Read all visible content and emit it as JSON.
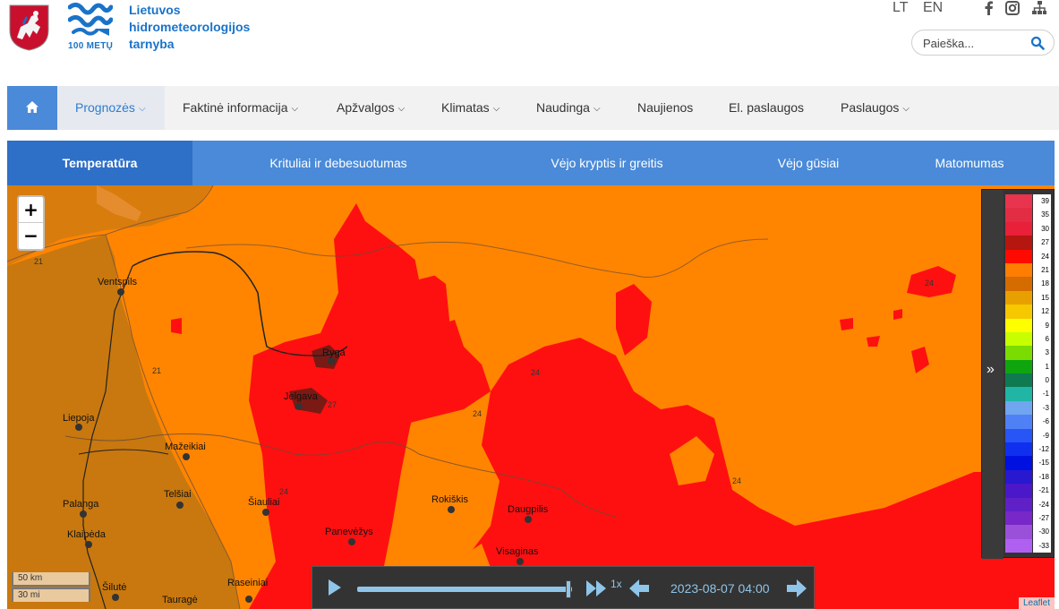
{
  "header": {
    "org_name_line1": "Lietuvos",
    "org_name_line2": "hidrometeorologijos",
    "org_name_line3": "tarnyba",
    "logo_caption": "100 METŲ",
    "languages": [
      "LT",
      "EN"
    ],
    "social_icons": [
      "facebook-icon",
      "instagram-icon",
      "sitemap-icon"
    ],
    "search_placeholder": "Paieška..."
  },
  "nav": {
    "home_icon": "home-icon",
    "items": [
      {
        "label": "Prognozės",
        "dropdown": true,
        "active": true
      },
      {
        "label": "Faktinė informacija",
        "dropdown": true
      },
      {
        "label": "Apžvalgos",
        "dropdown": true
      },
      {
        "label": "Klimatas",
        "dropdown": true
      },
      {
        "label": "Naudinga",
        "dropdown": true
      },
      {
        "label": "Naujienos",
        "dropdown": false
      },
      {
        "label": "El. paslaugos",
        "dropdown": false
      },
      {
        "label": "Paslaugos",
        "dropdown": true
      }
    ]
  },
  "tabs": [
    {
      "label": "Temperatūra",
      "active": true
    },
    {
      "label": "Krituliai ir debesuotumas"
    },
    {
      "label": "Vėjo kryptis ir greitis"
    },
    {
      "label": "Vėjo gūsiai"
    },
    {
      "label": "Matomumas"
    }
  ],
  "map": {
    "cities": [
      "Ventspils",
      "Ryga",
      "Jelgava",
      "Liepoja",
      "Mažeikiai",
      "Telšiai",
      "Šiauliai",
      "Rokiškis",
      "Daugpilis",
      "Palanga",
      "Klaipėda",
      "Panevėžys",
      "Visaginas",
      "Šilutė",
      "Raseiniai",
      "Tauragė"
    ],
    "contour_labels": [
      "21",
      "21",
      "24",
      "24",
      "24",
      "24",
      "24",
      "27"
    ],
    "scale": {
      "km": "50 km",
      "mi": "30 mi"
    },
    "attribution": "Leaflet",
    "zoom_in": "+",
    "zoom_out": "−"
  },
  "legend": {
    "toggle_icon": "double-chevron-right-icon",
    "items": [
      {
        "value": "39",
        "color": "#e8344e"
      },
      {
        "value": "35",
        "color": "#e32d45"
      },
      {
        "value": "30",
        "color": "#e8203a"
      },
      {
        "value": "27",
        "color": "#b5160f"
      },
      {
        "value": "24",
        "color": "#ff0a00"
      },
      {
        "value": "21",
        "color": "#ff7d00"
      },
      {
        "value": "18",
        "color": "#d46c00"
      },
      {
        "value": "15",
        "color": "#e8a000"
      },
      {
        "value": "12",
        "color": "#f5c800"
      },
      {
        "value": "9",
        "color": "#ffff00"
      },
      {
        "value": "6",
        "color": "#c8ff00"
      },
      {
        "value": "3",
        "color": "#7adc00"
      },
      {
        "value": "1",
        "color": "#0fa50f"
      },
      {
        "value": "0",
        "color": "#0f7a50"
      },
      {
        "value": "-1",
        "color": "#20b5a5"
      },
      {
        "value": "-3",
        "color": "#70a5f0"
      },
      {
        "value": "-6",
        "color": "#5080f5"
      },
      {
        "value": "-9",
        "color": "#2855f5"
      },
      {
        "value": "-12",
        "color": "#1030f0"
      },
      {
        "value": "-15",
        "color": "#0010e0"
      },
      {
        "value": "-18",
        "color": "#2818d0"
      },
      {
        "value": "-21",
        "color": "#4a18c8"
      },
      {
        "value": "-24",
        "color": "#6020c8"
      },
      {
        "value": "-27",
        "color": "#7828c8"
      },
      {
        "value": "-30",
        "color": "#9a50d8"
      },
      {
        "value": "-33",
        "color": "#b060f0"
      }
    ]
  },
  "player": {
    "play_icon": "play-icon",
    "fast_forward_icon": "fast-forward-icon",
    "speed": "1x",
    "back_icon": "arrow-left-icon",
    "timestamp": "2023-08-07 04:00",
    "forward_icon": "arrow-right-icon"
  },
  "colors": {
    "brand_blue": "#1a73c8",
    "nav_accent": "#4a8ad8",
    "tab_active": "#2e6fc7",
    "temp_21": "#ff8500",
    "temp_24": "#ff1000",
    "temp_18": "#d27a00",
    "temp_27": "#6e1a14"
  }
}
